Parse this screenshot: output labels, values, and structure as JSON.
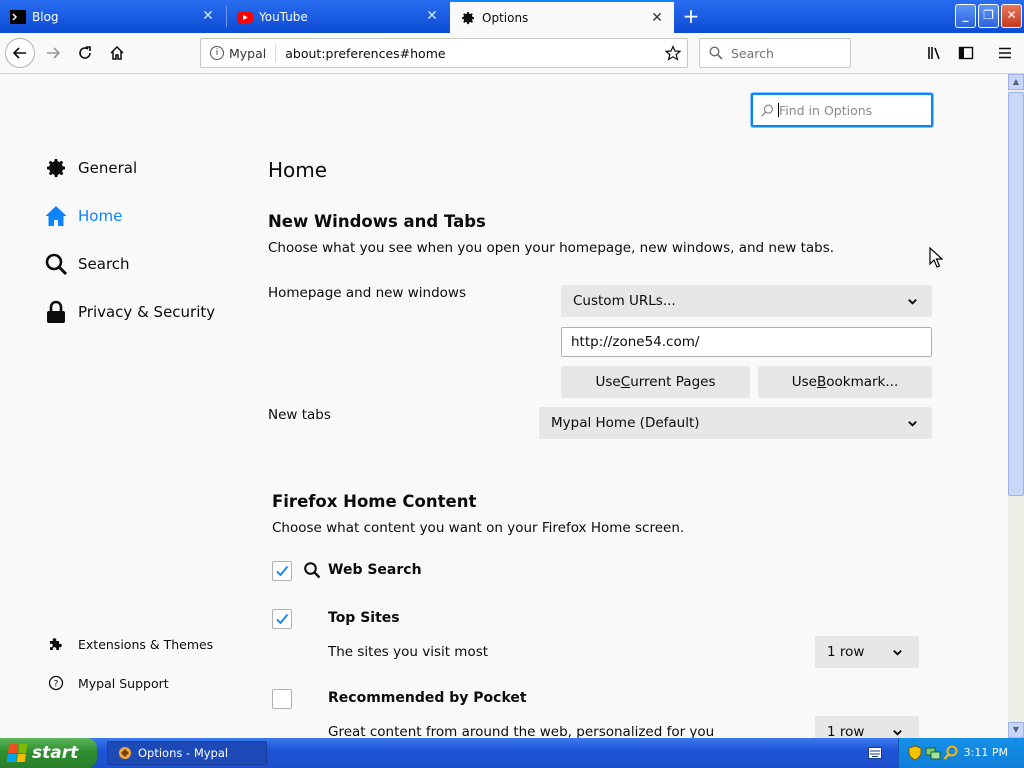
{
  "tabs": [
    {
      "label": "Blog",
      "favicon": "terminal-icon",
      "active": false
    },
    {
      "label": "YouTube",
      "favicon": "youtube-icon",
      "active": false
    },
    {
      "label": "Options",
      "favicon": "gear-icon",
      "active": true
    }
  ],
  "navbar": {
    "site_label": "Mypal",
    "url": "about:preferences#home",
    "search_placeholder": "Search"
  },
  "find": {
    "placeholder": "Find in Options"
  },
  "sidebar": {
    "categories": [
      {
        "label": "General",
        "icon": "gear-icon"
      },
      {
        "label": "Home",
        "icon": "home-icon",
        "selected": true
      },
      {
        "label": "Search",
        "icon": "search-icon"
      },
      {
        "label": "Privacy & Security",
        "icon": "lock-icon"
      }
    ],
    "footer": [
      {
        "label": "Extensions & Themes",
        "icon": "puzzle-icon"
      },
      {
        "label": "Mypal Support",
        "icon": "help-icon"
      }
    ]
  },
  "home": {
    "title": "Home",
    "section1": {
      "heading": "New Windows and Tabs",
      "description": "Choose what you see when you open your homepage, new windows, and new tabs.",
      "homepage_label": "Homepage and new windows",
      "homepage_select": "Custom URLs...",
      "homepage_url": "http://zone54.com/",
      "use_current_pre": "Use ",
      "use_current_key": "C",
      "use_current_post": "urrent Pages",
      "use_bookmark_pre": "Use ",
      "use_bookmark_key": "B",
      "use_bookmark_post": "ookmark...",
      "newtabs_label": "New tabs",
      "newtabs_select": "Mypal Home (Default)"
    },
    "section2": {
      "heading": "Firefox Home Content",
      "description": "Choose what content you want on your Firefox Home screen.",
      "web_search": "Web Search",
      "top_sites": "Top Sites",
      "top_sites_desc": "The sites you visit most",
      "top_sites_rows": "1 row",
      "pocket": "Recommended by Pocket",
      "pocket_desc": "Great content from around the web, personalized for you",
      "pocket_rows": "1 row"
    }
  },
  "taskbar": {
    "start_label": "start",
    "task_label": "Options - Mypal",
    "clock": "3:11 PM"
  },
  "colors": {
    "accent": "#0a84ff",
    "taskbar_blue": "#1f55d6",
    "start_green": "#2f8f2f"
  }
}
